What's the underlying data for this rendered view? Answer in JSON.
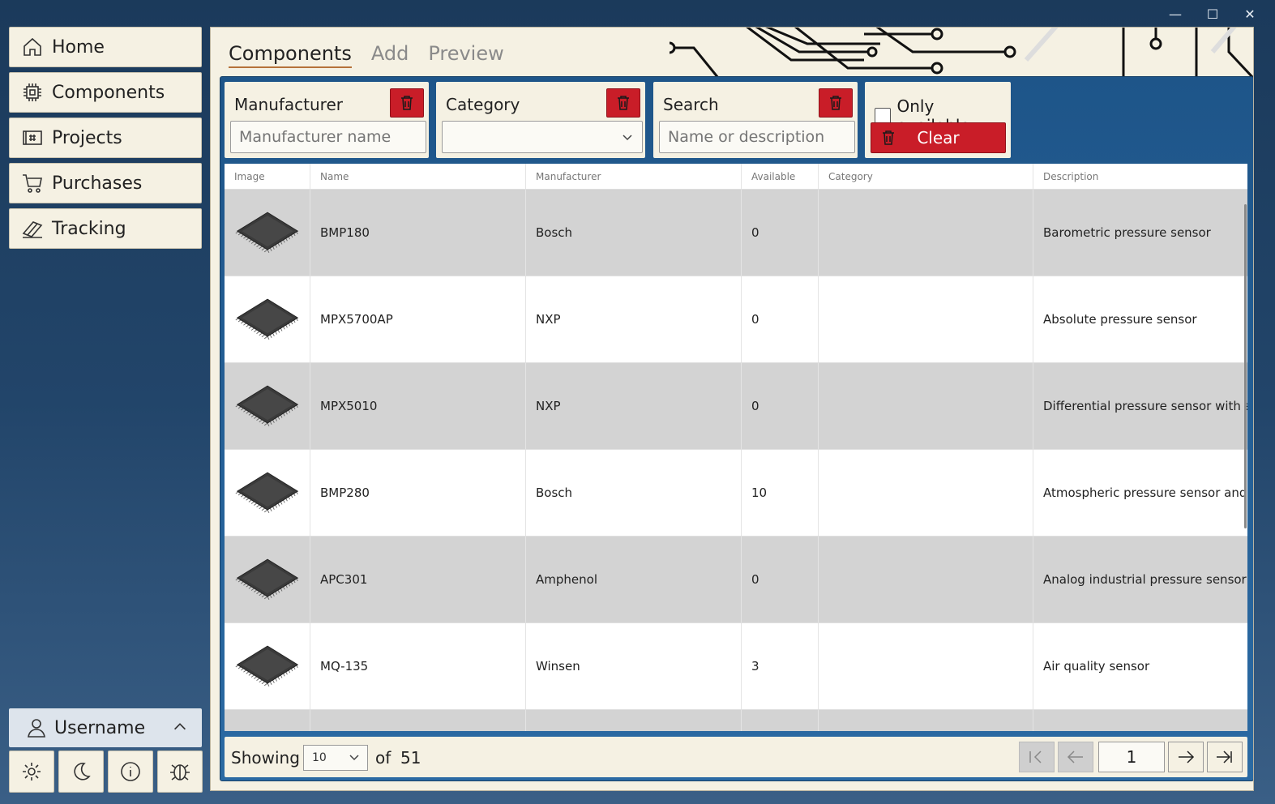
{
  "window": {
    "controls": [
      "minimize",
      "maximize",
      "close"
    ]
  },
  "sidebar": {
    "items": [
      {
        "label": "Home",
        "icon": "home-icon"
      },
      {
        "label": "Components",
        "icon": "chip-icon"
      },
      {
        "label": "Projects",
        "icon": "board-icon"
      },
      {
        "label": "Purchases",
        "icon": "cart-icon"
      },
      {
        "label": "Tracking",
        "icon": "tracking-icon"
      }
    ],
    "user": {
      "label": "Username"
    }
  },
  "tabs": {
    "components": "Components",
    "add": "Add",
    "preview": "Preview"
  },
  "filters": {
    "manufacturer": {
      "label": "Manufacturer",
      "placeholder": "Manufacturer name"
    },
    "category": {
      "label": "Category",
      "value": ""
    },
    "search": {
      "label": "Search",
      "placeholder": "Name or description"
    },
    "only_available": "Only available",
    "clear": "Clear"
  },
  "table": {
    "headers": [
      "Image",
      "Name",
      "Manufacturer",
      "Available",
      "Category",
      "Description"
    ],
    "rows": [
      {
        "name": "BMP180",
        "manufacturer": "Bosch",
        "available": "0",
        "category": "",
        "description": "Barometric pressure sensor"
      },
      {
        "name": "MPX5700AP",
        "manufacturer": "NXP",
        "available": "0",
        "category": "",
        "description": "Absolute pressure sensor"
      },
      {
        "name": "MPX5010",
        "manufacturer": "NXP",
        "available": "0",
        "category": "",
        "description": "Differential pressure sensor with a"
      },
      {
        "name": "BMP280",
        "manufacturer": "Bosch",
        "available": "10",
        "category": "",
        "description": "Atmospheric pressure sensor and"
      },
      {
        "name": "APC301",
        "manufacturer": "Amphenol",
        "available": "0",
        "category": "",
        "description": "Analog industrial pressure sensor"
      },
      {
        "name": "MQ-135",
        "manufacturer": "Winsen",
        "available": "3",
        "category": "",
        "description": "Air quality sensor"
      }
    ]
  },
  "pager": {
    "showing": "Showing",
    "page_size": "10",
    "of": "of",
    "total": "51",
    "page": "1"
  },
  "colors": {
    "accent_red": "#c91d28",
    "panel_blue": "#1e5589",
    "cream": "#f5f1e3",
    "tab_underline": "#b5723a"
  }
}
